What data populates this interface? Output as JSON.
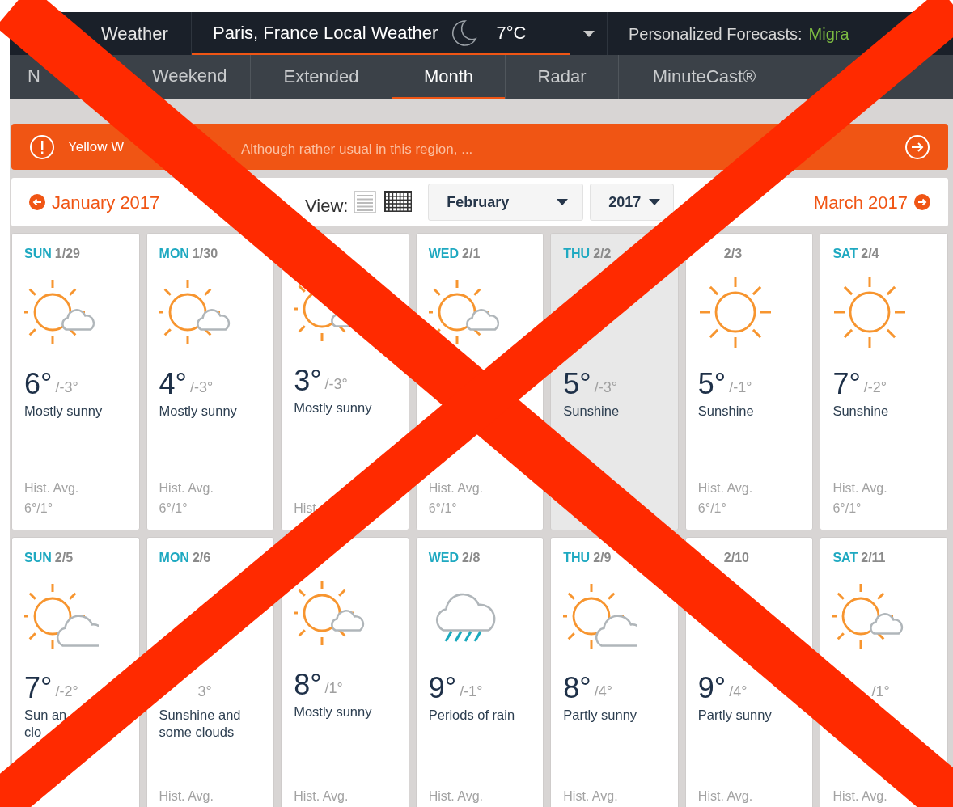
{
  "top_bar": {
    "items": [
      {
        "label": "Weather",
        "selected": false
      },
      {
        "label": "Paris, France Local Weather",
        "selected": true,
        "temperature": "7°C"
      }
    ],
    "personalized": {
      "label": "Personalized Forecasts:",
      "value": "Migra"
    }
  },
  "tabs": [
    {
      "label": "N",
      "selected": false
    },
    {
      "label": "Weekend",
      "selected": false
    },
    {
      "label": "Extended",
      "selected": false
    },
    {
      "label": "Month",
      "selected": true
    },
    {
      "label": "Radar",
      "selected": false
    },
    {
      "label": "MinuteCast®",
      "selected": false
    }
  ],
  "alert": {
    "title": "Yellow W",
    "message": "Although rather usual in this region, ..."
  },
  "month_nav": {
    "previous": "January 2017",
    "view_label": "View:",
    "view_modes": [
      {
        "kind": "list",
        "selected": false
      },
      {
        "kind": "grid",
        "selected": true
      }
    ],
    "month": "February",
    "year": "2017",
    "next": "March 2017"
  },
  "weeks": [
    [
      {
        "day": "SUN",
        "date": "1/29",
        "kind": "partly-sunny",
        "high": "6°",
        "low": "/-3°",
        "condition": "Mostly sunny",
        "hist_label": "Hist. Avg.",
        "hist_value": "6°/1°",
        "selected": false
      },
      {
        "day": "MON",
        "date": "1/30",
        "kind": "partly-sunny",
        "high": "4°",
        "low": "/-3°",
        "condition": "Mostly sunny",
        "hist_label": "Hist. Avg.",
        "hist_value": "6°/1°",
        "selected": false
      },
      {
        "kind": "partly-sunny",
        "high": "3°",
        "low": "/-3°",
        "condition": "Mostly sunny",
        "hist_label": "Hist",
        "selected": false
      },
      {
        "day": "WED",
        "date": "2/1",
        "kind": "partly-sunny",
        "hist_label": "Hist. Avg.",
        "hist_value": "6°/1°",
        "selected": false
      },
      {
        "day": "THU",
        "date": "2/2",
        "high": "5°",
        "low": "/-3°",
        "condition": "Sunshine",
        "selected": true
      },
      {
        "date": "2/3",
        "kind": "sunny",
        "high": "5°",
        "low": "/-1°",
        "condition": "Sunshine",
        "hist_label": "Hist. Avg.",
        "hist_value": "6°/1°",
        "selected": false
      },
      {
        "day": "SAT",
        "date": "2/4",
        "kind": "sunny",
        "high": "7°",
        "low": "/-2°",
        "condition": "Sunshine",
        "hist_label": "Hist. Avg.",
        "hist_value": "6°/1°",
        "selected": false
      }
    ],
    [
      {
        "day": "SUN",
        "date": "2/5",
        "kind": "sun-and-cloud",
        "high": "7°",
        "low": "/-2°",
        "condition": "Sun an\nclo",
        "selected": false
      },
      {
        "day": "MON",
        "date": "2/6",
        "low": "3°",
        "condition": "Sunshine and some clouds",
        "hist_label": "Hist. Avg.",
        "selected": false
      },
      {
        "kind": "partly-sunny",
        "high": "8°",
        "low": "/1°",
        "condition": "Mostly sunny",
        "hist_label": "Hist. Avg.",
        "selected": false
      },
      {
        "day": "WED",
        "date": "2/8",
        "kind": "rain",
        "high": "9°",
        "low": "/-1°",
        "condition": "Periods of rain",
        "hist_label": "Hist. Avg.",
        "selected": false
      },
      {
        "day": "THU",
        "date": "2/9",
        "kind": "sun-and-cloud",
        "high": "8°",
        "low": "/4°",
        "condition": "Partly sunny",
        "hist_label": "Hist. Avg.",
        "selected": false
      },
      {
        "date": "2/10",
        "high": "9°",
        "low": "/4°",
        "condition": "Partly sunny",
        "hist_label": "Hist. Avg.",
        "selected": false
      },
      {
        "day": "SAT",
        "date": "2/11",
        "kind": "partly-sunny",
        "low": "/1°",
        "hist_label": "Hist. Avg.",
        "selected": false
      }
    ]
  ],
  "crossed_out": true
}
